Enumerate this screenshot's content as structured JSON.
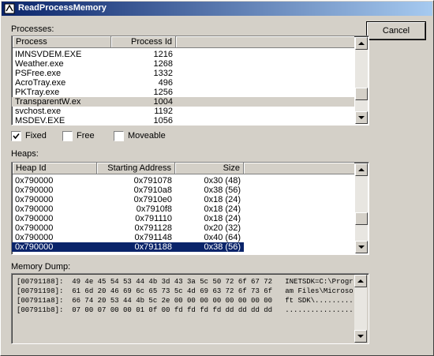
{
  "window": {
    "title": "ReadProcessMemory"
  },
  "buttons": {
    "cancel": "Cancel"
  },
  "processes": {
    "label": "Processes:",
    "columns": [
      "Process",
      "Process Id"
    ],
    "rows": [
      {
        "name": "IMNSVDEM.EXE",
        "pid": "1216"
      },
      {
        "name": "Weather.exe",
        "pid": "1268"
      },
      {
        "name": "PSFree.exe",
        "pid": "1332"
      },
      {
        "name": "AcroTray.exe",
        "pid": "496"
      },
      {
        "name": "PKTray.exe",
        "pid": "1256"
      },
      {
        "name": "TransparentW.ex",
        "pid": "1004"
      },
      {
        "name": "svchost.exe",
        "pid": "1192"
      },
      {
        "name": "MSDEV.EXE",
        "pid": "1056"
      }
    ],
    "highlighted_row": 5
  },
  "filters": [
    {
      "label": "Fixed",
      "checked": true
    },
    {
      "label": "Free",
      "checked": false
    },
    {
      "label": "Moveable",
      "checked": false
    }
  ],
  "heaps": {
    "label": "Heaps:",
    "columns": [
      "Heap Id",
      "Starting Address",
      "Size"
    ],
    "rows": [
      {
        "id": "0x790000",
        "addr": "0x791078",
        "size": "0x30 (48)"
      },
      {
        "id": "0x790000",
        "addr": "0x7910a8",
        "size": "0x38 (56)"
      },
      {
        "id": "0x790000",
        "addr": "0x7910e0",
        "size": "0x18 (24)"
      },
      {
        "id": "0x790000",
        "addr": "0x7910f8",
        "size": "0x18 (24)"
      },
      {
        "id": "0x790000",
        "addr": "0x791110",
        "size": "0x18 (24)"
      },
      {
        "id": "0x790000",
        "addr": "0x791128",
        "size": "0x20 (32)"
      },
      {
        "id": "0x790000",
        "addr": "0x791148",
        "size": "0x40 (64)"
      },
      {
        "id": "0x790000",
        "addr": "0x791188",
        "size": "0x38 (56)"
      }
    ],
    "selected_row": 7
  },
  "memory_dump": {
    "label": "Memory Dump:",
    "lines": [
      "[00791188]:  49 4e 45 54 53 44 4b 3d 43 3a 5c 50 72 6f 67 72   INETSDK=C:\\Progr",
      "[00791198]:  61 6d 20 46 69 6c 65 73 5c 4d 69 63 72 6f 73 6f   am Files\\Microso",
      "[007911a8]:  66 74 20 53 44 4b 5c 2e 00 00 00 00 00 00 00 00   ft SDK\\.........",
      "[007911b8]:  07 00 07 00 00 01 0f 00 fd fd fd fd dd dd dd dd   ................"
    ]
  }
}
